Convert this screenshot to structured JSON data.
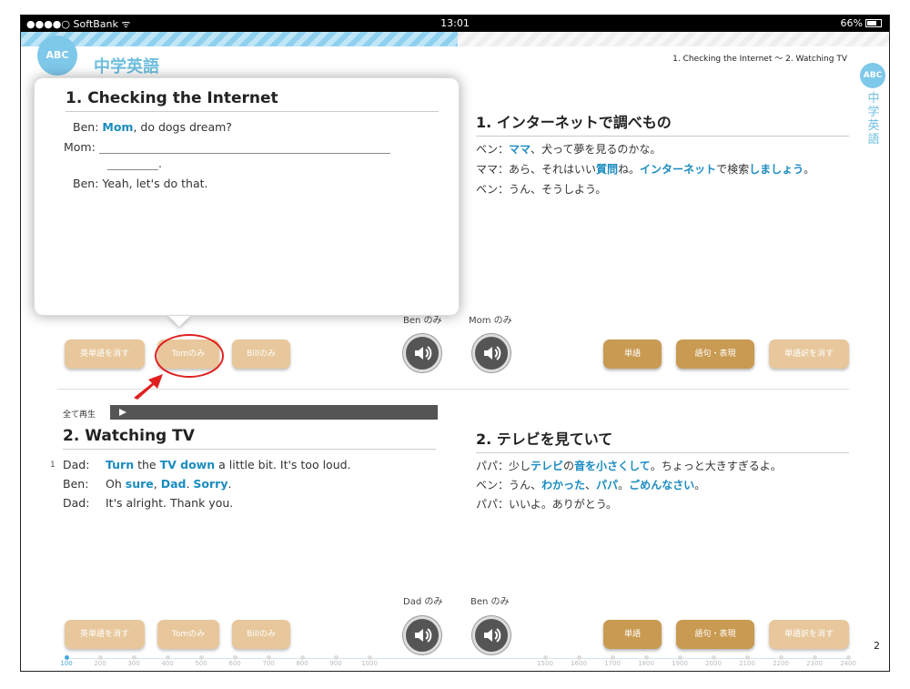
{
  "statusbar": {
    "carrier": "●●●●○ SoftBank ᯤ",
    "time": "13:01",
    "battery": "66%"
  },
  "app": {
    "logo": "ABC",
    "title": "中学英語",
    "breadcrumb": "1. Checking the Internet ～ 2. Watching TV",
    "side_title": "中学英語"
  },
  "popup": {
    "title": "1. Checking the Internet",
    "line1_speaker": "Ben:",
    "line1_word": "Mom",
    "line1_rest": ", do dogs dream?",
    "line2_speaker": "Mom:",
    "line3_end": ".",
    "line4_speaker": "Ben:",
    "line4_text": "Yeah, let's do that."
  },
  "section1_jp": {
    "title": "1. インターネットで調べもの",
    "l1_a": "ベン：",
    "l1_hl": "ママ",
    "l1_b": "、犬って夢を見るのかな。",
    "l2_a": "ママ：あら、それはいい",
    "l2_hl1": "質問",
    "l2_b": "ね。",
    "l2_hl2": "インターネット",
    "l2_c": "で検索",
    "l2_hl3": "しましょう",
    "l2_d": "。",
    "l3": "ベン：うん、そうしよう。"
  },
  "section1_controls": {
    "ben_only": "Ben のみ",
    "mom_only": "Mom のみ",
    "erase_english": "英単語を消す",
    "tom_only": "Tomのみ",
    "bill_only": "Billのみ",
    "words": "単語",
    "phrases": "語句・表現",
    "erase_translation": "単語訳を消す"
  },
  "playall": {
    "label": "全て再生"
  },
  "section2_en": {
    "title": "2. Watching TV",
    "line_number": "1",
    "l1_speaker": "Dad:",
    "l1_hl1": "Turn",
    "l1_a": " the ",
    "l1_hl2": "TV down",
    "l1_b": " a little bit.  It's too loud.",
    "l2_speaker": "Ben:",
    "l2_a": "Oh ",
    "l2_hl1": "sure",
    "l2_b": ", ",
    "l2_hl2": "Dad",
    "l2_c": ".  ",
    "l2_hl3": "Sorry",
    "l2_d": ".",
    "l3_speaker": "Dad:",
    "l3_text": "It's alright.  Thank you."
  },
  "section2_jp": {
    "title": "2. テレビを見ていて",
    "l1_a": "パパ：少し",
    "l1_hl1": "テレビ",
    "l1_b": "の",
    "l1_hl2": "音を小さくして",
    "l1_c": "。ちょっと大きすぎるよ。",
    "l2_a": "ベン：うん、",
    "l2_hl1": "わかった",
    "l2_b": "、",
    "l2_hl2": "パパ",
    "l2_c": "。",
    "l2_hl3": "ごめんなさい",
    "l2_d": "。",
    "l3": "パパ：いいよ。ありがとう。"
  },
  "section2_controls": {
    "dad_only": "Dad のみ",
    "ben_only": "Ben のみ",
    "erase_english": "英単語を消す",
    "tom_only": "Tomのみ",
    "bill_only": "Billのみ",
    "words": "単語",
    "phrases": "語句・表現",
    "erase_translation": "単語訳を消す"
  },
  "page_number": "2",
  "timeline": {
    "ticks_left": [
      "100",
      "200",
      "300",
      "400",
      "500",
      "600",
      "700",
      "800",
      "900",
      "1000"
    ],
    "ticks_right": [
      "1500",
      "1600",
      "1700",
      "1800",
      "1900",
      "2000",
      "2100",
      "2200",
      "2300",
      "2400"
    ]
  },
  "colors": {
    "highlight": "#1a8bc0",
    "accent": "#7ec8ea",
    "button_light": "#e7c79b",
    "button_dark": "#c99a52",
    "annotation_red": "#e02020"
  }
}
